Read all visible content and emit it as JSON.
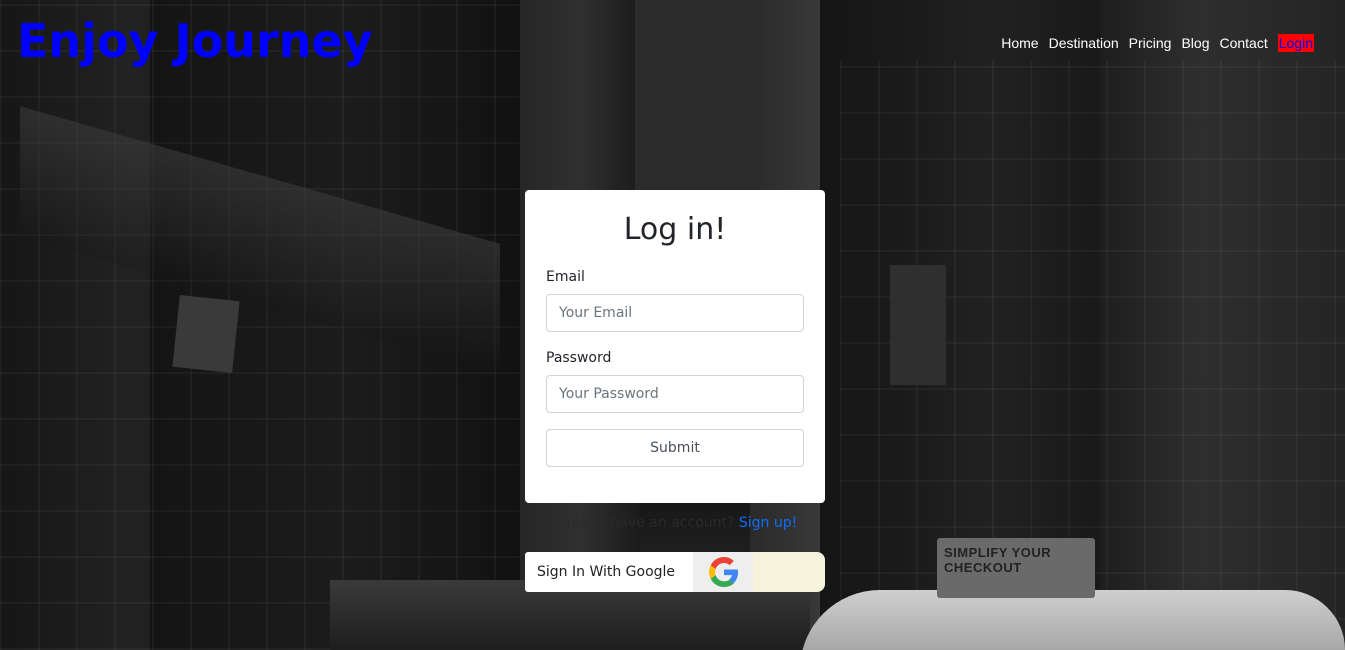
{
  "header": {
    "brand": "Enjoy Journey",
    "nav": [
      {
        "label": "Home"
      },
      {
        "label": "Destination"
      },
      {
        "label": "Pricing"
      },
      {
        "label": "Blog"
      },
      {
        "label": "Contact"
      },
      {
        "label": "Login",
        "active": true
      }
    ]
  },
  "login": {
    "title": "Log in!",
    "email_label": "Email",
    "email_placeholder": "Your Email",
    "email_value": "",
    "password_label": "Password",
    "password_placeholder": "Your Password",
    "password_value": "",
    "submit_label": "Submit"
  },
  "signup": {
    "prompt": "Already have an account?",
    "link": "Sign up!"
  },
  "google": {
    "label": "Sign In With Google",
    "icon": "google-icon"
  },
  "background": {
    "sign_text": "SIMPLIFY YOUR CHECKOUT"
  },
  "colors": {
    "brand": "#0000ff",
    "login_active_bg": "#ff0000",
    "link": "#0d6efd"
  }
}
